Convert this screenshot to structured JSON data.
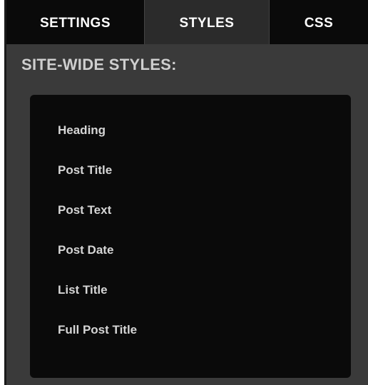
{
  "tabs": [
    {
      "label": "SETTINGS"
    },
    {
      "label": "STYLES"
    },
    {
      "label": "CSS"
    }
  ],
  "active_tab": "STYLES",
  "section": {
    "title": "SITE-WIDE STYLES:"
  },
  "style_items": [
    {
      "label": "Heading"
    },
    {
      "label": "Post Title"
    },
    {
      "label": "Post Text"
    },
    {
      "label": "Post Date"
    },
    {
      "label": "List Title"
    },
    {
      "label": "Full Post Title"
    }
  ],
  "colors": {
    "tabbar": "#0a0a0a",
    "active_tab": "#2b2b2b",
    "panel": "#3a3a3a",
    "box": "#0a0a0a",
    "text": "#d6d6d6"
  }
}
